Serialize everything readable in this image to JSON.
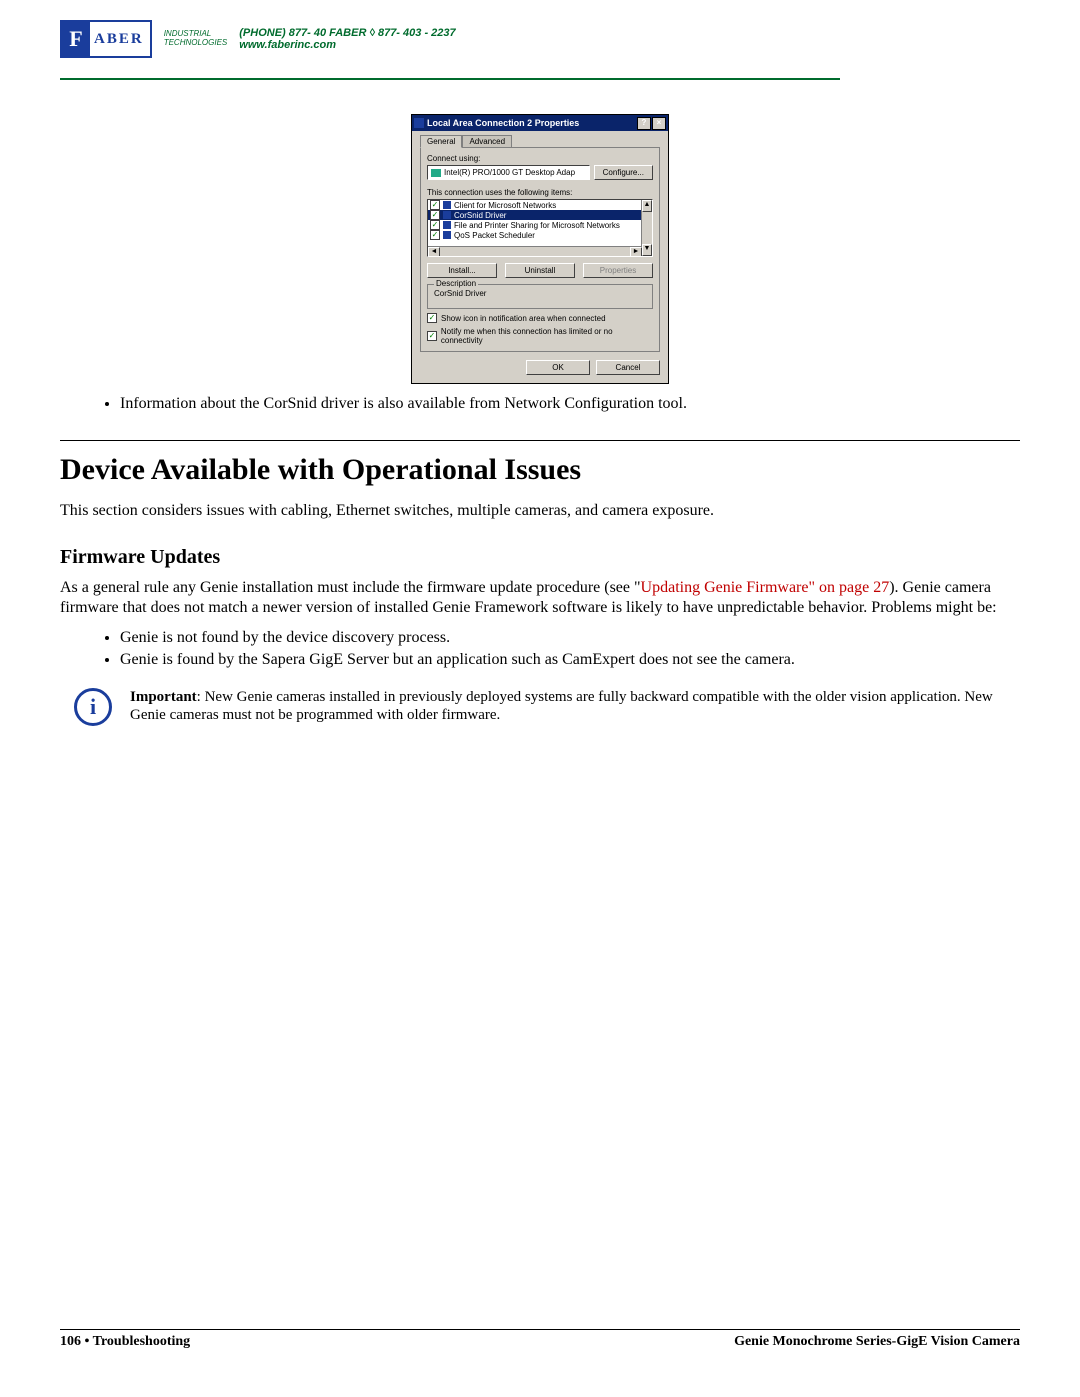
{
  "header": {
    "logo_f": "F",
    "logo_name": "ABER",
    "logo_sub1": "INDUSTRIAL",
    "logo_sub2": "TECHNOLOGIES",
    "phone": "(PHONE) 877- 40 FABER  ◊  877- 403 - 2237",
    "url": "www.faberinc.com"
  },
  "dialog": {
    "title": "Local Area Connection 2 Properties",
    "help_btn": "?",
    "close_btn": "×",
    "tab_general": "General",
    "tab_advanced": "Advanced",
    "connect_using": "Connect using:",
    "adapter": "Intel(R) PRO/1000 GT Desktop Adap",
    "configure": "Configure...",
    "uses_items": "This connection uses the following items:",
    "items": [
      "Client for Microsoft Networks",
      "CorSnid Driver",
      "File and Printer Sharing for Microsoft Networks",
      "QoS Packet Scheduler"
    ],
    "install": "Install...",
    "uninstall": "Uninstall",
    "properties": "Properties",
    "desc_label": "Description",
    "desc_text": "CorSnid Driver",
    "show_icon": "Show icon in notification area when connected",
    "notify": "Notify me when this connection has limited or no connectivity",
    "ok": "OK",
    "cancel": "Cancel"
  },
  "content": {
    "bullet1": "Information about the CorSnid driver is also available from Network Configuration tool.",
    "h1": "Device Available with Operational Issues",
    "intro": "This section considers issues with cabling, Ethernet switches, multiple cameras, and camera exposure.",
    "h2": "Firmware Updates",
    "fw_p_pre": "As a general rule any Genie installation must include the firmware update procedure (see \"",
    "fw_link": "Updating Genie Firmware\" on page 27",
    "fw_p_post": "). Genie camera firmware that does not match a newer version of installed Genie Framework software is likely to have unpredictable behavior. Problems might be:",
    "fw_b1": "Genie is not found by the device discovery process.",
    "fw_b2": "Genie is found by the Sapera GigE Server but an application such as CamExpert does not see the camera.",
    "note_strong": "Important",
    "note_body": ": New Genie cameras installed in previously deployed systems are fully backward compatible with the older vision application. New Genie cameras must not be programmed with older firmware."
  },
  "footer": {
    "left_page": "106",
    "left_sep": "  •  ",
    "left_section": "Troubleshooting",
    "right": "Genie Monochrome Series-GigE Vision Camera"
  }
}
